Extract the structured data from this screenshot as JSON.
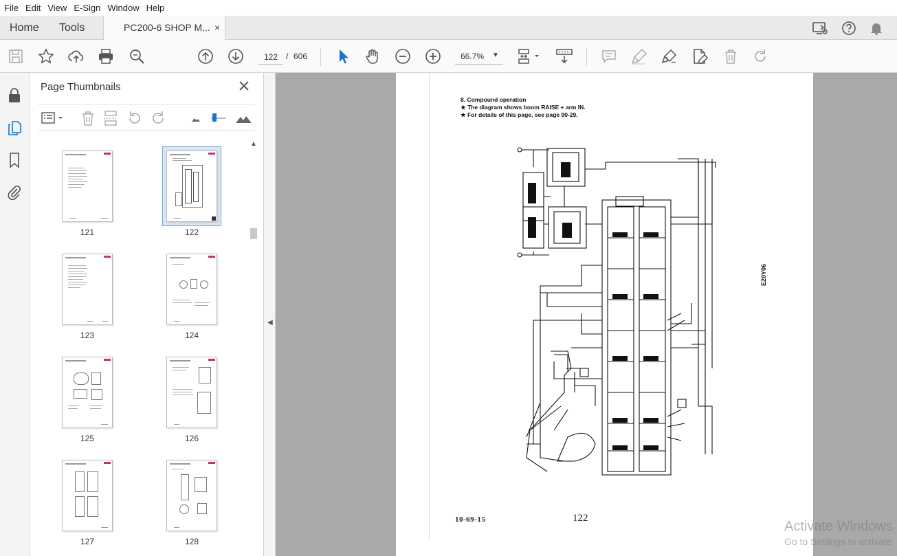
{
  "menu": [
    "File",
    "Edit",
    "View",
    "E-Sign",
    "Window",
    "Help"
  ],
  "tabs": {
    "home": "Home",
    "tools": "Tools",
    "document": "PC200-6 SHOP M...",
    "close_glyph": "×"
  },
  "toolbar": {
    "page_number": "122",
    "page_separator": "/",
    "page_total": "606",
    "zoom": "66.7%",
    "dropdown_glyph": "▼"
  },
  "thumbnail_panel": {
    "title": "Page Thumbnails",
    "selected_page": "122",
    "pages": [
      "121",
      "122",
      "123",
      "124",
      "125",
      "126",
      "127",
      "128"
    ]
  },
  "document_page": {
    "section_heading": "8.   Compound operation",
    "notes": [
      "★   The diagram shows boom RAISE + arm IN.",
      "★   For details of this page, see page 90-29."
    ],
    "side_code": "E20Y06",
    "footer_code": "10-69-15",
    "footer_page": "122"
  },
  "watermark": {
    "line1": "Activate Windows",
    "line2": "Go to Settings to activate"
  },
  "colors": {
    "accent_blue": "#1a73c8",
    "toolbar_bg": "#fafafa",
    "document_bg": "#a9a9a9",
    "selection": "#d9e7f5"
  }
}
